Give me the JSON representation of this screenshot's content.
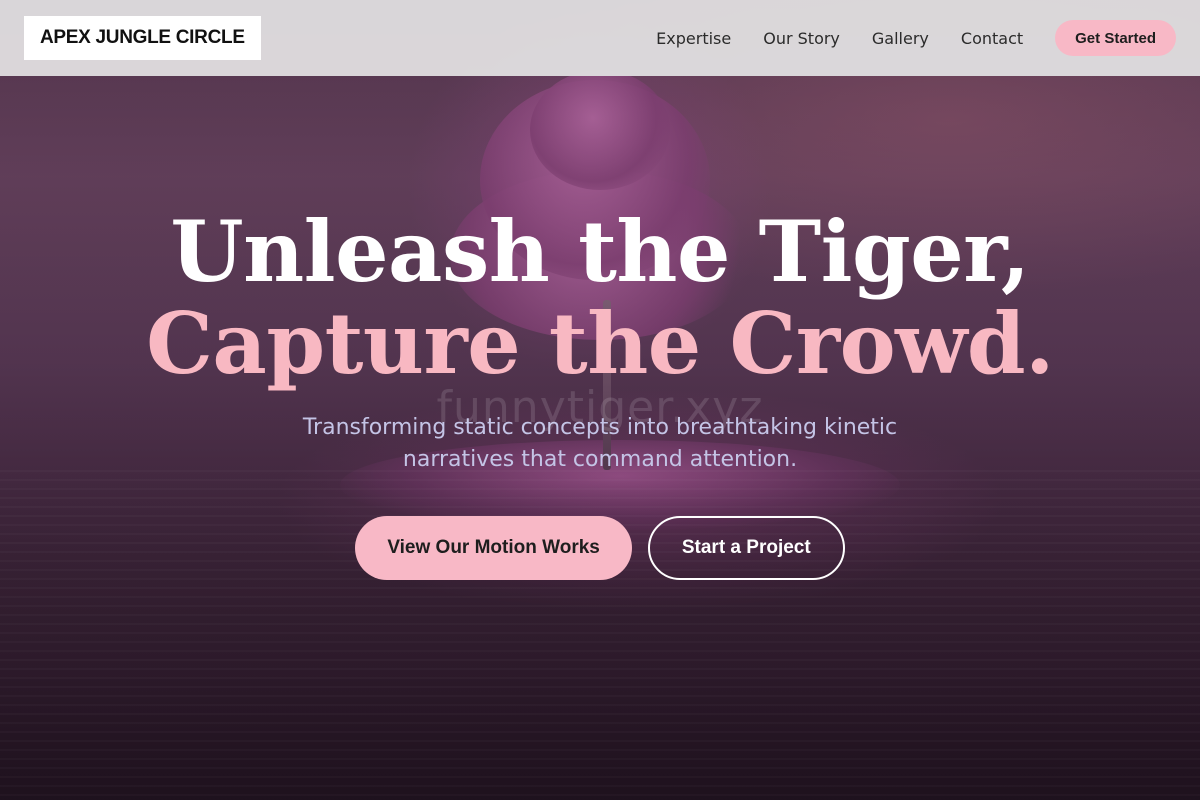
{
  "header": {
    "logo_text": "APEX JUNGLE CIRCLE",
    "nav_links": [
      {
        "label": "Expertise"
      },
      {
        "label": "Our Story"
      },
      {
        "label": "Gallery"
      },
      {
        "label": "Contact"
      }
    ],
    "cta_label": "Get Started"
  },
  "hero": {
    "headline_line1": "Unleash the Tiger,",
    "headline_line2": "Capture the Crowd.",
    "watermark": "funnytiger.xyz",
    "subtitle": "Transforming static concepts into breathtaking kinetic narratives that command attention.",
    "primary_button": "View Our Motion Works",
    "secondary_button": "Start a Project"
  },
  "colors": {
    "accent_pink": "#f8b8c6",
    "headline_pink": "#f8b8c2",
    "subtitle_lavender": "#c4c4e6",
    "nav_background": "#dedcde"
  }
}
